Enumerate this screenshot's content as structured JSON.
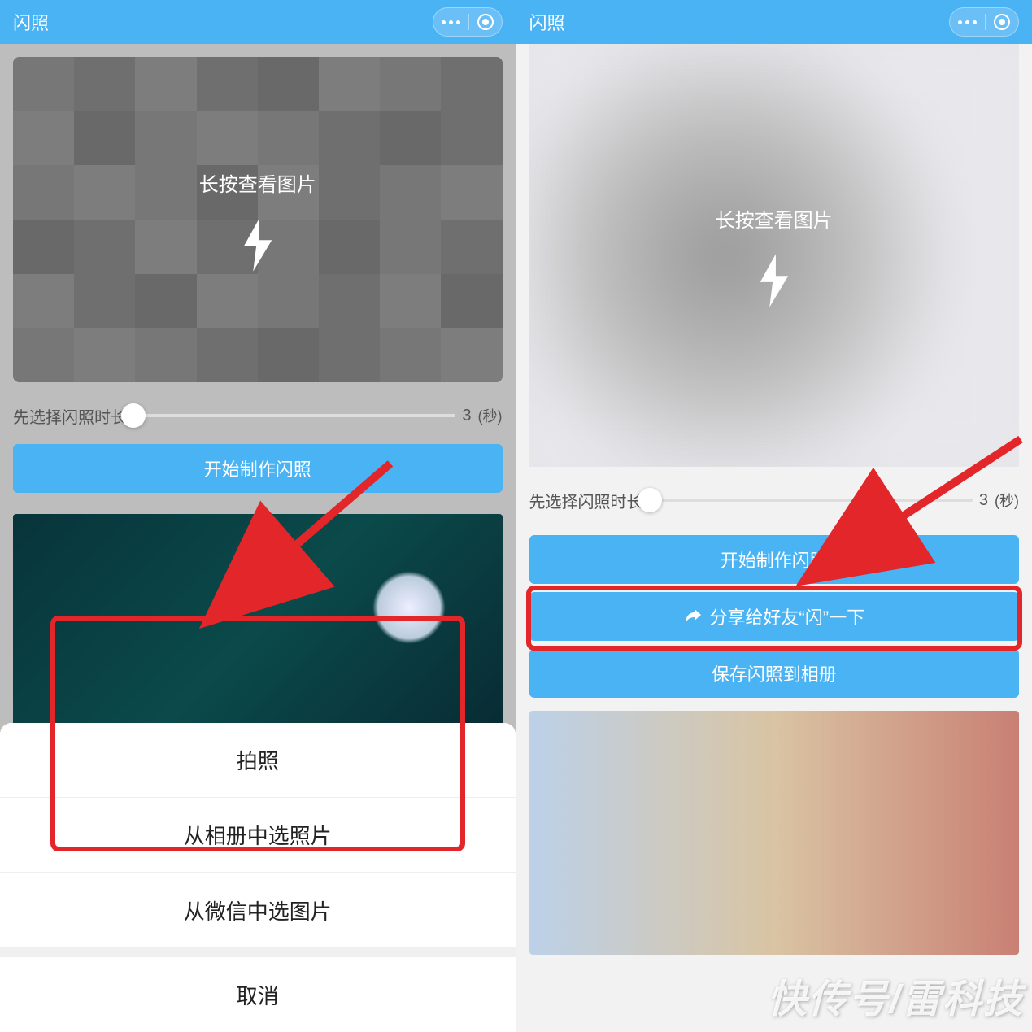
{
  "app": {
    "title": "闪照"
  },
  "preview": {
    "hint": "长按查看图片"
  },
  "slider": {
    "label": "先选择闪照时长",
    "value": "3",
    "unit": "(秒)"
  },
  "buttons": {
    "make": "开始制作闪照",
    "make_partial": "开始制作闪照",
    "share": "分享给好友“闪”一下",
    "save": "保存闪照到相册"
  },
  "sheet": {
    "take_photo": "拍照",
    "from_album": "从相册中选照片",
    "from_wechat": "从微信中选图片",
    "cancel": "取消"
  },
  "watermark": "快传号/雷科技"
}
